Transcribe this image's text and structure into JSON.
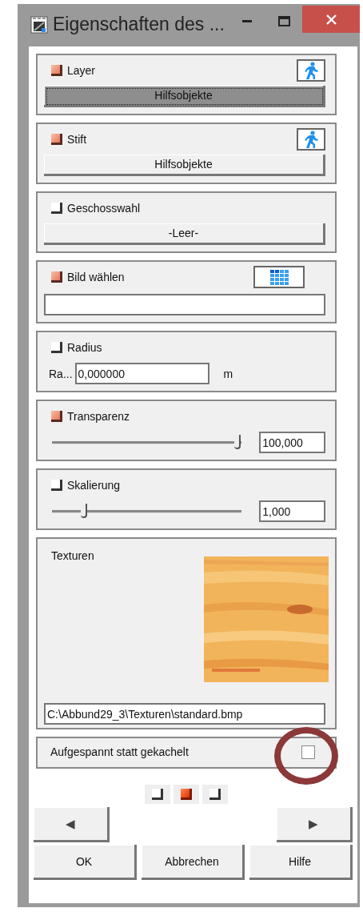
{
  "window": {
    "title": "Eigenschaften des ..."
  },
  "sections": [
    {
      "kind": "action",
      "label": "Layer",
      "active": true,
      "button": "Hilfsobjekte",
      "focused": true
    },
    {
      "kind": "action",
      "label": "Stift",
      "active": true,
      "button": "Hilfsobjekte",
      "focused": false
    },
    {
      "kind": "button",
      "label": "Geschosswahl",
      "active": false,
      "button": "-Leer-",
      "focused": false
    },
    {
      "kind": "field",
      "label": "Bild wählen",
      "active": true
    },
    {
      "kind": "number",
      "label": "Radius",
      "active": false,
      "field_label": "Ra...",
      "value": "0,000000",
      "unit": "m"
    },
    {
      "kind": "slider",
      "label": "Transparenz",
      "active": true,
      "level": 0.98,
      "value": "100,000"
    },
    {
      "kind": "slider",
      "label": "Skalierung",
      "active": false,
      "level": 0.17,
      "value": "1,000"
    },
    {
      "kind": "texture",
      "label": "Texturen",
      "path": "C:\\Abbund29_3\\Texturen\\standard.bmp"
    },
    {
      "kind": "checkbox",
      "label": "Aufgespannt statt gekachelt",
      "checked": false,
      "circled": true
    }
  ],
  "pages": [
    {
      "selected": false
    },
    {
      "selected": true
    },
    {
      "selected": false
    }
  ],
  "nav": {
    "previous": "◀",
    "next": "▶"
  },
  "buttons": [
    "OK",
    "Abbrechen",
    "Hilfe"
  ]
}
